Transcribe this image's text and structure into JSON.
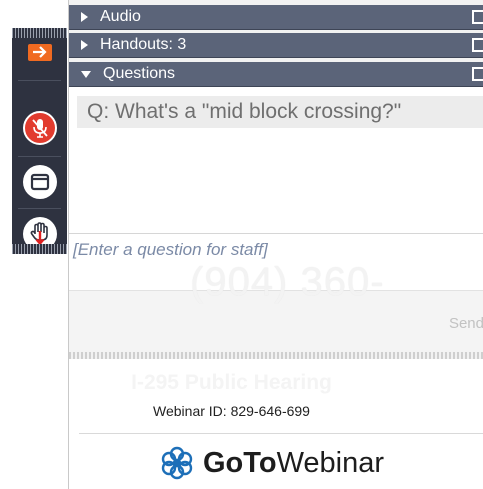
{
  "toolbar": {
    "buttons": [
      {
        "name": "collapse-panel",
        "icon": "arrow-right-icon",
        "color": "#f06a21"
      },
      {
        "name": "microphone",
        "icon": "mic-muted-icon",
        "color": "#e23b2e"
      },
      {
        "name": "window",
        "icon": "window-icon"
      },
      {
        "name": "raise-hand",
        "icon": "hand-icon",
        "color": "#e02020"
      }
    ]
  },
  "panels": {
    "audio": {
      "label": "Audio"
    },
    "handouts": {
      "label": "Handouts: 3"
    },
    "questions": {
      "label": "Questions",
      "items": [
        "Q: What's a \"mid block crossing?\""
      ],
      "input_placeholder": "[Enter a question for staff]",
      "send_label": "Send"
    }
  },
  "watermark": {
    "phone": "(904) 360-"
  },
  "webinar": {
    "title": "I-295 Public Hearing",
    "id_text": "Webinar ID: 829-646-699"
  },
  "brand": {
    "logo_icon": "gotowebinar-flower-icon",
    "name_bold": "GoTo",
    "name_regular": "Webinar",
    "color": "#1d6fb8"
  },
  "colors": {
    "header_bar": "#5b6479",
    "toolbar_bg": "#2e3240",
    "accent_orange": "#f06a21"
  }
}
